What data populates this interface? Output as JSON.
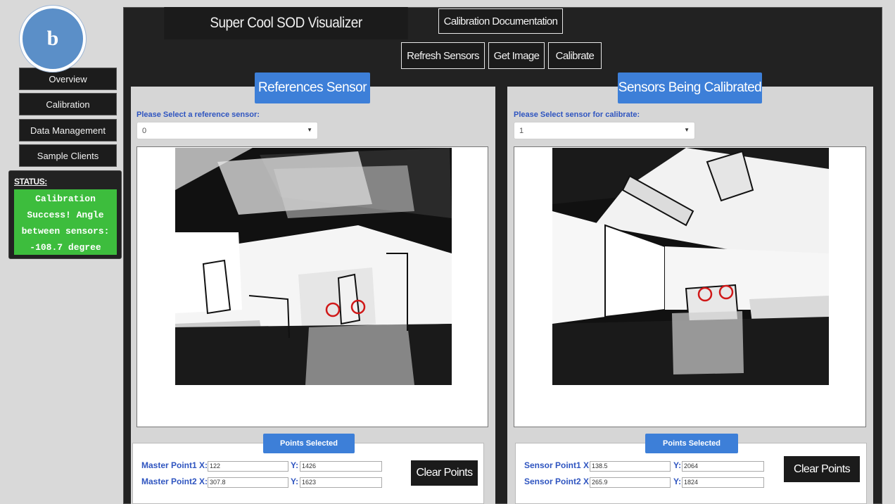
{
  "badge": "b",
  "sidebar": {
    "items": [
      {
        "label": "Overview"
      },
      {
        "label": "Calibration"
      },
      {
        "label": "Data Management"
      },
      {
        "label": "Sample Clients"
      }
    ]
  },
  "status": {
    "title": "STATUS:",
    "lines": [
      "Calibration",
      "Success! Angle",
      "between sensors:",
      "-108.7 degree"
    ],
    "color": "#3dbd3d"
  },
  "app": {
    "title": "Super Cool SOD Visualizer",
    "docs_button": "Calibration Documentation",
    "toolbar": {
      "refresh": "Refresh Sensors",
      "get_image": "Get Image",
      "calibrate": "Calibrate"
    }
  },
  "reference": {
    "header": "References Sensor",
    "select_label": "Please Select a reference sensor:",
    "select_value": "0",
    "points_header": "Points Selected",
    "points": [
      {
        "label": "Master Point1",
        "x": "122",
        "y": "1426"
      },
      {
        "label": "Master Point2",
        "x": "307.8",
        "y": "1623"
      }
    ],
    "clear_label": "Clear Points"
  },
  "calibrated": {
    "header": "Sensors Being Calibrated",
    "select_label": "Please Select sensor for calibrate:",
    "select_value": "1",
    "points_header": "Points Selected",
    "points": [
      {
        "label": "Sensor Point1",
        "x": "138.5",
        "y": "2064"
      },
      {
        "label": "Sensor Point2",
        "x": "265.9",
        "y": "1824"
      }
    ],
    "clear_label": "Clear Points"
  },
  "labels": {
    "x": "X:",
    "y": "Y:"
  },
  "colors": {
    "accent": "#3d7fd8",
    "dark": "#1b1b1b",
    "status_green": "#3dbd3d",
    "marker": "#d01818"
  }
}
